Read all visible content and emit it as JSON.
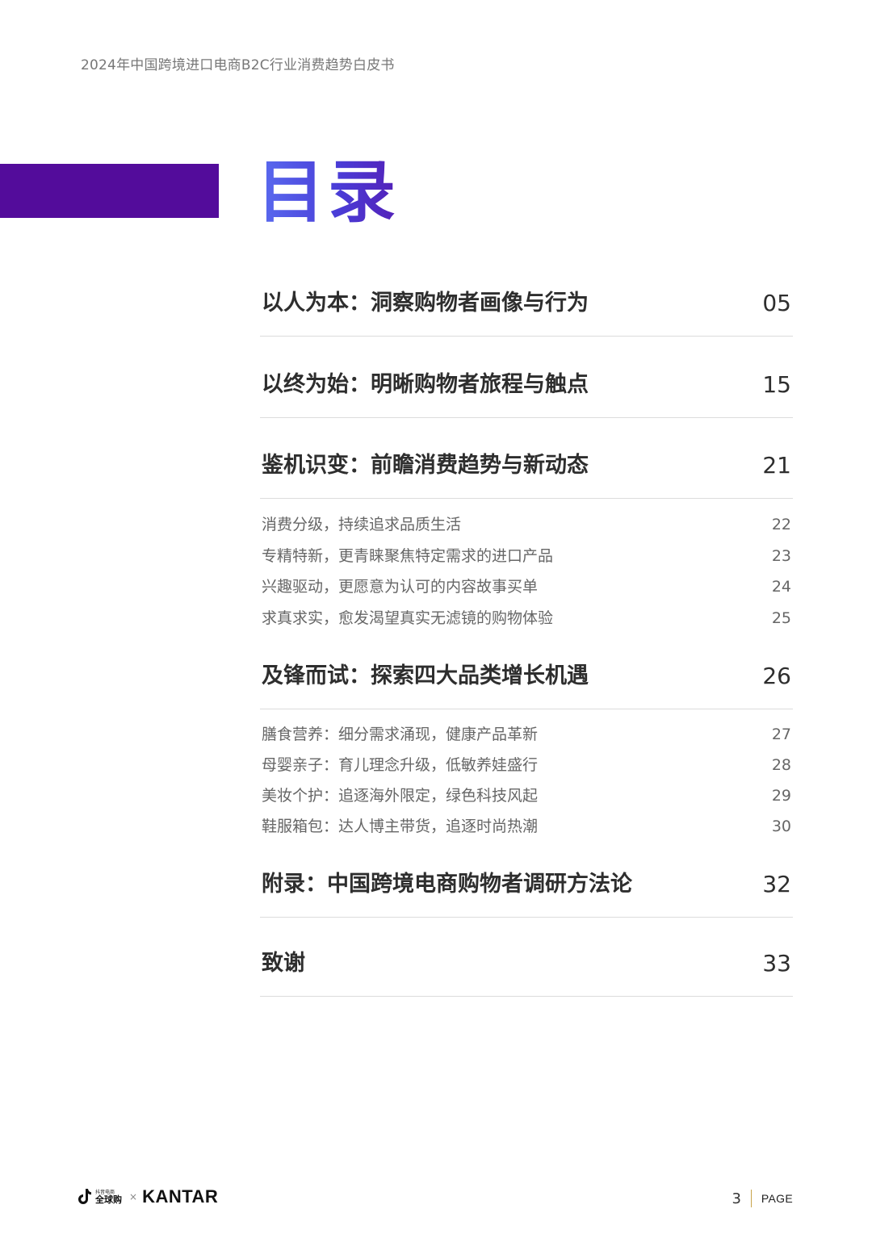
{
  "header": {
    "running_title": "2024年中国跨境进口电商B2C行业消费趋势白皮书"
  },
  "toc": {
    "title": "目录",
    "entries": [
      {
        "label": "以人为本：洞察购物者画像与行为",
        "page": "05"
      },
      {
        "label": "以终为始：明晰购物者旅程与触点",
        "page": "15"
      },
      {
        "label": "鉴机识变：前瞻消费趋势与新动态",
        "page": "21",
        "subs": [
          {
            "label": "消费分级，持续追求品质生活",
            "page": "22"
          },
          {
            "label": "专精特新，更青睐聚焦特定需求的进口产品",
            "page": "23"
          },
          {
            "label": "兴趣驱动，更愿意为认可的内容故事买单",
            "page": "24"
          },
          {
            "label": "求真求实，愈发渴望真实无滤镜的购物体验",
            "page": "25"
          }
        ]
      },
      {
        "label": "及锋而试：探索四大品类增长机遇",
        "page": "26",
        "subs": [
          {
            "label": "膳食营养：细分需求涌现，健康产品革新",
            "page": "27"
          },
          {
            "label": "母婴亲子：育儿理念升级，低敏养娃盛行",
            "page": "28"
          },
          {
            "label": "美妆个护：追逐海外限定，绿色科技风起",
            "page": "29"
          },
          {
            "label": "鞋服箱包：达人博主带货，追逐时尚热潮",
            "page": "30"
          }
        ]
      },
      {
        "label": "附录：中国跨境电商购物者调研方法论",
        "page": "32"
      },
      {
        "label": "致谢",
        "page": "33"
      }
    ]
  },
  "footer": {
    "brand_small": "抖音电商",
    "brand_main": "全球购",
    "separator": "×",
    "partner": "KANTAR",
    "page_number": "3",
    "page_word": "PAGE"
  },
  "colors": {
    "accent_bar": "#530c9b",
    "title_gradient_start": "#5a6cf0",
    "title_gradient_end": "#5320b8",
    "footer_divider": "#c8a44a"
  }
}
